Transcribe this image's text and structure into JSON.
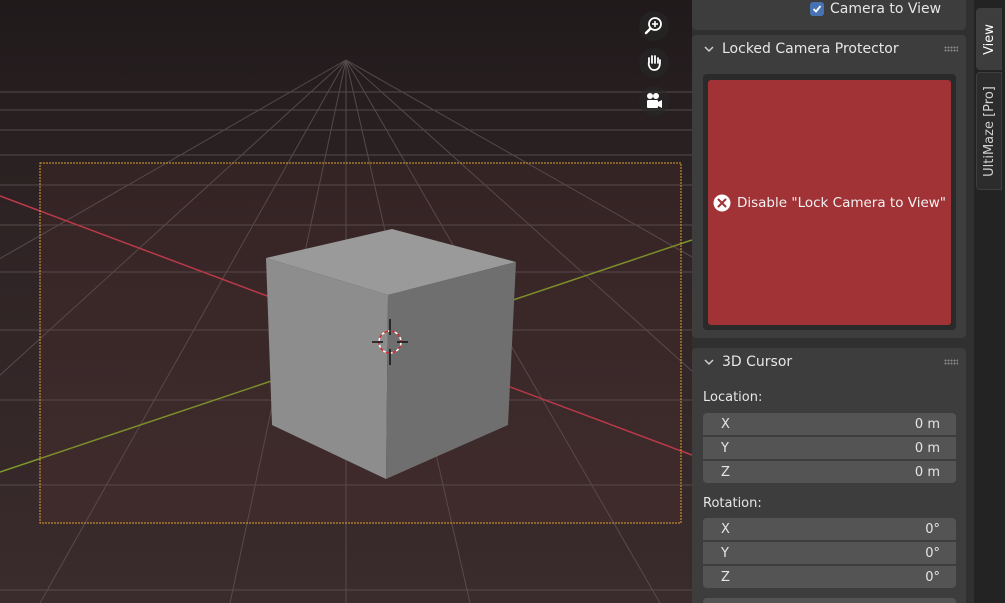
{
  "viewport": {
    "icons": [
      "zoom-in-icon",
      "hand-pan-icon",
      "camera-icon"
    ]
  },
  "sidebar": {
    "camera_to_view": {
      "label": "Camera to View",
      "checked": true
    },
    "locked_camera_panel": {
      "title": "Locked Camera Protector",
      "warning_button_label": "Disable \"Lock Camera to View\"",
      "warning_color": "#a13236"
    },
    "cursor_panel": {
      "title": "3D Cursor",
      "location_label": "Location:",
      "location": [
        {
          "axis": "X",
          "value": "0 m"
        },
        {
          "axis": "Y",
          "value": "0 m"
        },
        {
          "axis": "Z",
          "value": "0 m"
        }
      ],
      "rotation_label": "Rotation:",
      "rotation": [
        {
          "axis": "X",
          "value": "0°"
        },
        {
          "axis": "Y",
          "value": "0°"
        },
        {
          "axis": "Z",
          "value": "0°"
        }
      ]
    }
  },
  "tabs": [
    {
      "label": "View",
      "active": true
    },
    {
      "label": "UltiMaze [Pro]",
      "active": false
    }
  ],
  "colors": {
    "accent": "#4772b3",
    "x_axis": "#c23a4a",
    "y_axis": "#7c9a2a",
    "camera_frame": "#e0a030"
  }
}
